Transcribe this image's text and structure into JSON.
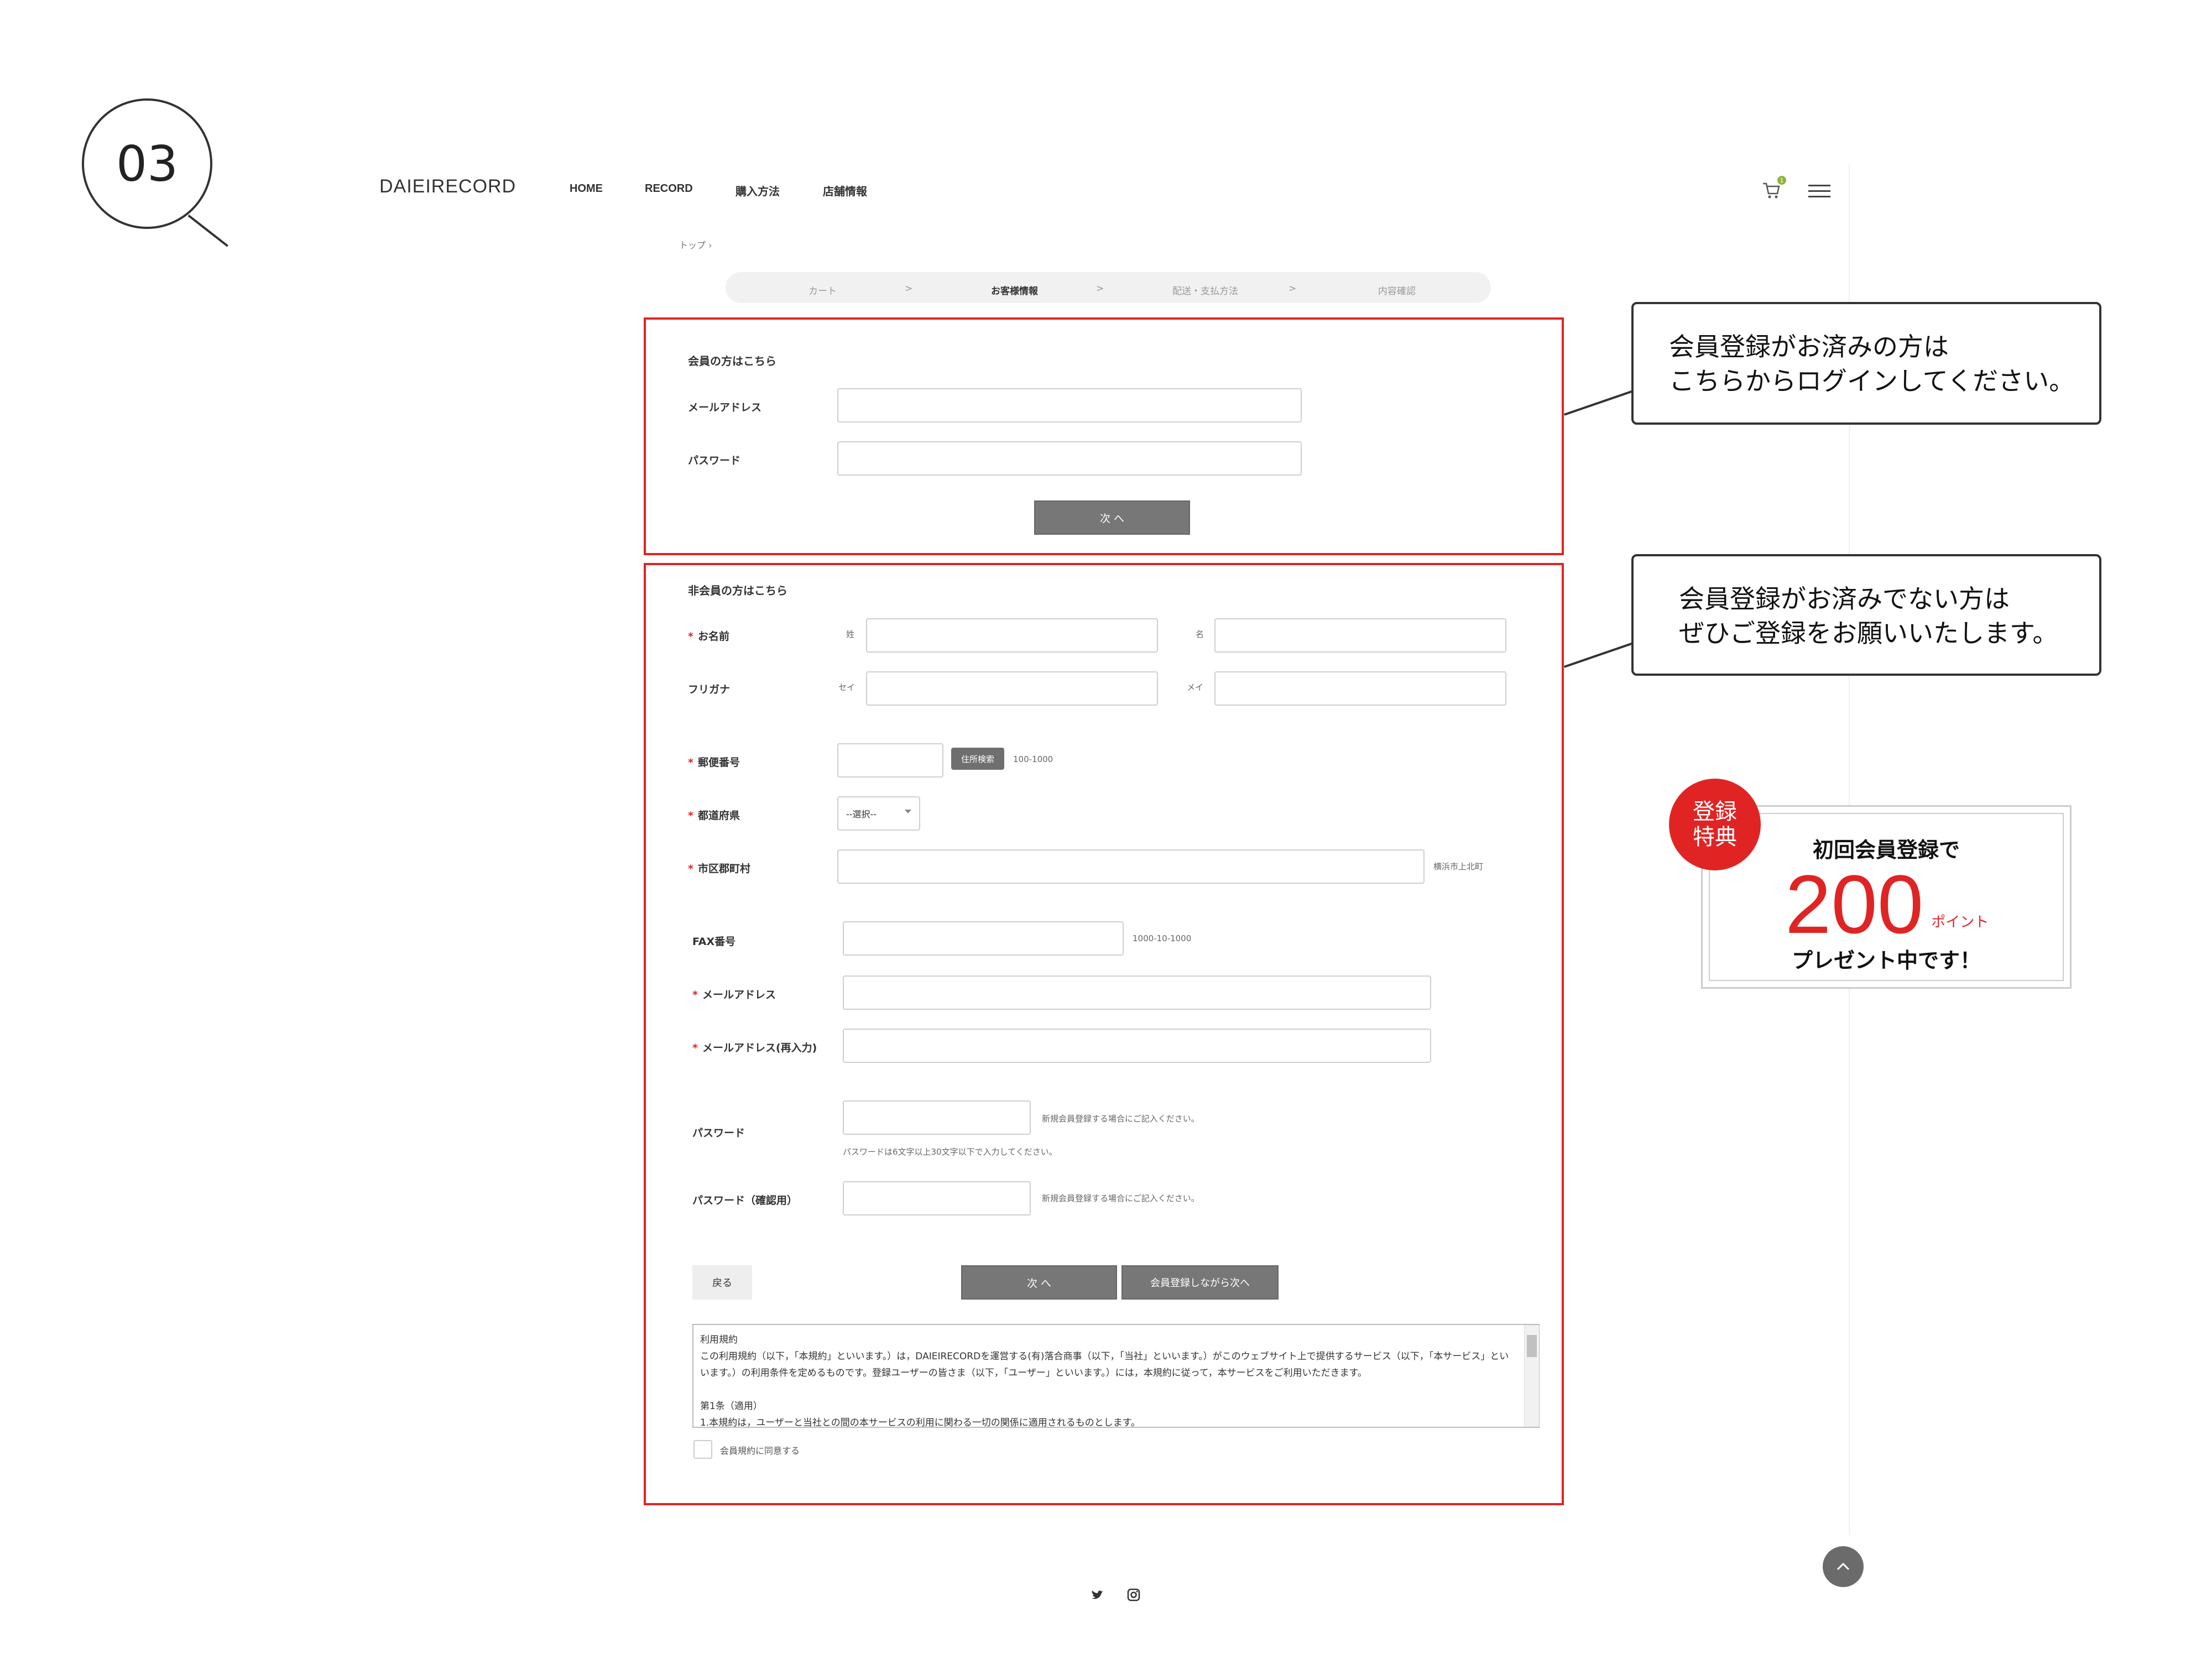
{
  "step_number": "03",
  "site": {
    "logo": "DAIEIRECORD",
    "nav": [
      "HOME",
      "RECORD",
      "購入方法",
      "店舗情報"
    ],
    "cart_count": "1"
  },
  "breadcrumb": "トップ ›",
  "progress": {
    "steps": [
      "カート",
      "お客様情報",
      "配送・支払方法",
      "内容確認"
    ],
    "separator": ">",
    "active_index": 1
  },
  "member_section": {
    "title": "会員の方はこちら",
    "email_label": "メールアドレス",
    "password_label": "パスワード",
    "next_button": "次 へ"
  },
  "guest_section": {
    "title": "非会員の方はこちら",
    "required_mark": "*",
    "name_label": "お名前",
    "last_name_prefix": "姓",
    "first_name_prefix": "名",
    "kana_label": "フリガナ",
    "kana_last_prefix": "セイ",
    "kana_first_prefix": "メイ",
    "postal_label": "郵便番号",
    "postal_search_button": "住所検索",
    "postal_hint": "100-1000",
    "prefecture_label": "都道府県",
    "prefecture_value": "--選択--",
    "city_label": "市区郡町村",
    "city_hint": "横浜市上北町",
    "fax_label": "FAX番号",
    "fax_hint": "1000-10-1000",
    "email_label": "メールアドレス",
    "email_confirm_label": "メールアドレス(再入力)",
    "password_label": "パスワード",
    "password_hint": "新規会員登録する場合にご記入ください。",
    "password_rule": "パスワードは6文字以上30文字以下で入力してください。",
    "password_confirm_label": "パスワード（確認用）",
    "password_confirm_hint": "新規会員登録する場合にご記入ください。",
    "back_button": "戻る",
    "next_button": "次 へ",
    "register_next_button": "会員登録しながら次へ",
    "terms_title": "利用規約",
    "terms_p1": "この利用規約（以下，「本規約」といいます。）は，DAIEIRECORDを運営する(有)落合商事（以下，「当社」といいます。）がこのウェブサイト上で提供するサービス（以下，「本サービス」といいます。）の利用条件を定めるものです。登録ユーザーの皆さま（以下，「ユーザー」といいます。）には，本規約に従って，本サービスをご利用いただきます。",
    "terms_article": "第1条（適用）",
    "terms_p2": "1.本規約は，ユーザーと当社との間の本サービスの利用に関わる一切の関係に適用されるものとします。",
    "agree_label": "会員規約に同意する"
  },
  "callouts": {
    "member_line1": "会員登録がお済みの方は",
    "member_line2": "こちらからログインしてください。",
    "guest_line1": "会員登録がお済みでない方は",
    "guest_line2": "ぜひご登録をお願いいたします。"
  },
  "promo": {
    "badge_line1": "登録",
    "badge_line2": "特典",
    "line1": "初回会員登録で",
    "points": "200",
    "unit": "ポイント",
    "line3": "プレゼント中です！"
  },
  "colors": {
    "accent_red": "#e02424",
    "button_gray": "#777777",
    "cart_badge": "#8fb43a"
  }
}
